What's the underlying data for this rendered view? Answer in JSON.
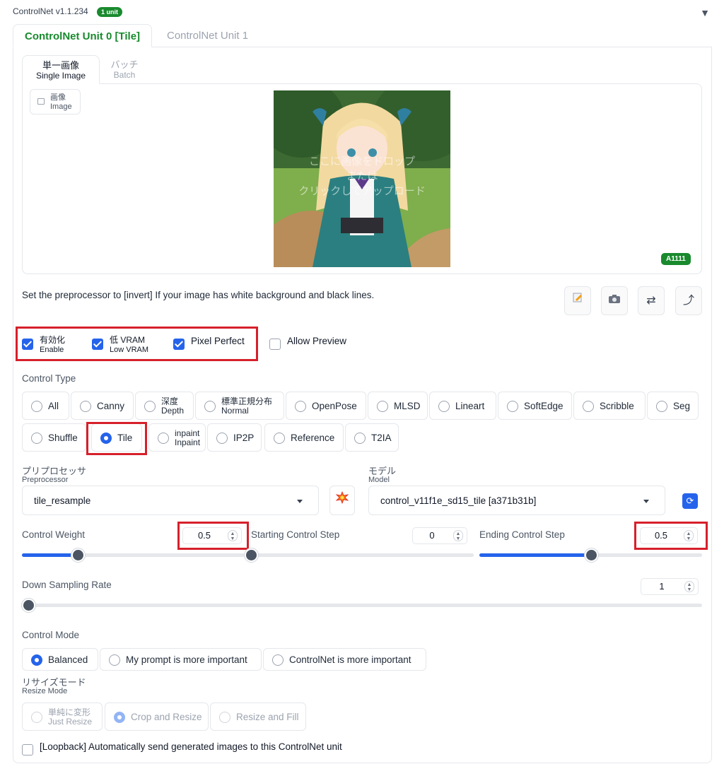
{
  "header": {
    "title": "ControlNet v1.1.234",
    "badge": "1 unit",
    "collapse_icon": "▼"
  },
  "unit_tabs": [
    {
      "label": "ControlNet Unit 0 [Tile]",
      "active": true
    },
    {
      "label": "ControlNet Unit 1",
      "active": false
    }
  ],
  "image_tabs": [
    {
      "label_ja": "単一画像",
      "label_en": "Single Image",
      "active": true
    },
    {
      "label_ja": "バッチ",
      "label_en": "Batch",
      "active": false
    }
  ],
  "image_panel": {
    "label_ja": "画像",
    "label_en": "Image",
    "overlay_lines": [
      "ここに画像をドロップ",
      "または",
      "クリックしてアップロード"
    ],
    "badge": "A1111"
  },
  "hint_text": "Set the preprocessor to [invert] If your image has white background and black lines.",
  "tool_icons": [
    "edit-icon",
    "camera-icon",
    "swap-icon",
    "send-dimensions-icon"
  ],
  "checkboxes": {
    "enable": {
      "ja": "有効化",
      "en": "Enable",
      "checked": true
    },
    "low_vram": {
      "ja": "低 VRAM",
      "en": "Low VRAM",
      "checked": true
    },
    "pixel_perfect": {
      "label": "Pixel Perfect",
      "checked": true
    },
    "allow_preview": {
      "label": "Allow Preview",
      "checked": false
    }
  },
  "control_type": {
    "label": "Control Type",
    "options": [
      {
        "label": "All"
      },
      {
        "label": "Canny"
      },
      {
        "ja": "深度",
        "en": "Depth"
      },
      {
        "ja": "標準正規分布",
        "en": "Normal"
      },
      {
        "label": "OpenPose"
      },
      {
        "label": "MLSD"
      },
      {
        "label": "Lineart"
      },
      {
        "label": "SoftEdge"
      },
      {
        "label": "Scribble"
      },
      {
        "label": "Seg"
      },
      {
        "label": "Shuffle"
      },
      {
        "label": "Tile",
        "checked": true
      },
      {
        "ja": "inpaint",
        "en": "Inpaint"
      },
      {
        "label": "IP2P"
      },
      {
        "label": "Reference"
      },
      {
        "label": "T2IA"
      }
    ]
  },
  "preprocessor": {
    "ja": "プリプロセッサ",
    "en": "Preprocessor",
    "value": "tile_resample"
  },
  "model": {
    "ja": "モデル",
    "en": "Model",
    "value": "control_v11f1e_sd15_tile [a371b31b]"
  },
  "sliders": {
    "control_weight": {
      "label": "Control Weight",
      "value": "0.5",
      "fraction": 0.25
    },
    "starting_step": {
      "label": "Starting Control Step",
      "value": "0",
      "fraction": 0.0
    },
    "ending_step": {
      "label": "Ending Control Step",
      "value": "0.5",
      "fraction": 0.5
    },
    "down_sampling": {
      "label": "Down Sampling Rate",
      "value": "1",
      "fraction": 0.0
    }
  },
  "control_mode": {
    "label": "Control Mode",
    "options": [
      {
        "label": "Balanced",
        "checked": true
      },
      {
        "label": "My prompt is more important"
      },
      {
        "label": "ControlNet is more important"
      }
    ]
  },
  "resize_mode": {
    "ja": "リサイズモード",
    "en": "Resize Mode",
    "options": [
      {
        "ja": "単純に変形",
        "en": "Just Resize"
      },
      {
        "label": "Crop and Resize",
        "checked": true
      },
      {
        "label": "Resize and Fill"
      }
    ]
  },
  "loopback": {
    "label": "[Loopback] Automatically send generated images to this ControlNet unit",
    "checked": false
  }
}
